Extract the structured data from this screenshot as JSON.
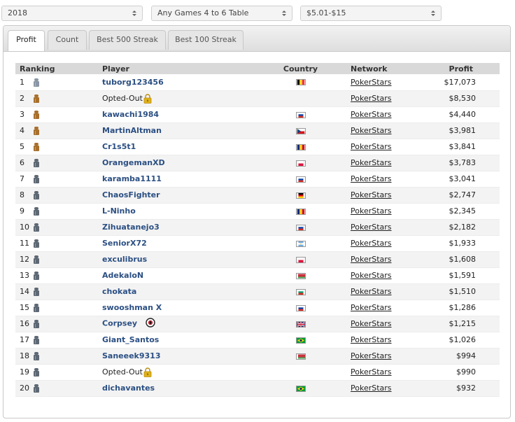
{
  "filters": {
    "year": "2018",
    "games": "Any Games 4 to 6 Table",
    "stakes": "$5.01-$15"
  },
  "tabs": [
    "Profit",
    "Count",
    "Best 500 Streak",
    "Best 100 Streak"
  ],
  "active_tab": "Profit",
  "table": {
    "headers": {
      "ranking": "Ranking",
      "player": "Player",
      "country": "Country",
      "network": "Network",
      "profit": "Profit"
    },
    "rows": [
      {
        "rank": "1",
        "player": "tuborg123456",
        "opted_out": false,
        "country_flag": "belgium",
        "network": "PokerStars",
        "profit": "$17,073",
        "chip": "silver"
      },
      {
        "rank": "2",
        "player": "Opted-Out",
        "opted_out": true,
        "country_flag": "",
        "network": "PokerStars",
        "profit": "$8,530",
        "chip": "bronze"
      },
      {
        "rank": "3",
        "player": "kawachi1984",
        "opted_out": false,
        "country_flag": "russia",
        "network": "PokerStars",
        "profit": "$4,440",
        "chip": "bronze"
      },
      {
        "rank": "4",
        "player": "MartinAltman",
        "opted_out": false,
        "country_flag": "czech",
        "network": "PokerStars",
        "profit": "$3,981",
        "chip": "bronze"
      },
      {
        "rank": "5",
        "player": "Cr1s5t1",
        "opted_out": false,
        "country_flag": "romania",
        "network": "PokerStars",
        "profit": "$3,841",
        "chip": "bronze"
      },
      {
        "rank": "6",
        "player": "OrangemanXD",
        "opted_out": false,
        "country_flag": "poland",
        "network": "PokerStars",
        "profit": "$3,783",
        "chip": "gray"
      },
      {
        "rank": "7",
        "player": "karamba1111",
        "opted_out": false,
        "country_flag": "russia",
        "network": "PokerStars",
        "profit": "$3,041",
        "chip": "gray"
      },
      {
        "rank": "8",
        "player": "ChaosFighter",
        "opted_out": false,
        "country_flag": "germany",
        "network": "PokerStars",
        "profit": "$2,747",
        "chip": "gray"
      },
      {
        "rank": "9",
        "player": "L-Ninho",
        "opted_out": false,
        "country_flag": "romania",
        "network": "PokerStars",
        "profit": "$2,345",
        "chip": "gray"
      },
      {
        "rank": "10",
        "player": "Zihuatanejo3",
        "opted_out": false,
        "country_flag": "russia",
        "network": "PokerStars",
        "profit": "$2,182",
        "chip": "gray"
      },
      {
        "rank": "11",
        "player": "SeniorX72",
        "opted_out": false,
        "country_flag": "argentina",
        "network": "PokerStars",
        "profit": "$1,933",
        "chip": "gray"
      },
      {
        "rank": "12",
        "player": "exculibrus",
        "opted_out": false,
        "country_flag": "poland",
        "network": "PokerStars",
        "profit": "$1,608",
        "chip": "gray"
      },
      {
        "rank": "13",
        "player": "AdekaloN",
        "opted_out": false,
        "country_flag": "belarus",
        "network": "PokerStars",
        "profit": "$1,591",
        "chip": "gray"
      },
      {
        "rank": "14",
        "player": "chokata",
        "opted_out": false,
        "country_flag": "bulgaria",
        "network": "PokerStars",
        "profit": "$1,510",
        "chip": "gray"
      },
      {
        "rank": "15",
        "player": "swooshman X",
        "opted_out": false,
        "country_flag": "russia",
        "network": "PokerStars",
        "profit": "$1,286",
        "chip": "gray"
      },
      {
        "rank": "16",
        "player": "Corpsey",
        "opted_out": false,
        "country_flag": "uk",
        "network": "PokerStars",
        "profit": "$1,215",
        "chip": "gray",
        "badge": true
      },
      {
        "rank": "17",
        "player": "Giant_Santos",
        "opted_out": false,
        "country_flag": "brazil",
        "network": "PokerStars",
        "profit": "$1,026",
        "chip": "gray"
      },
      {
        "rank": "18",
        "player": "Saneeek9313",
        "opted_out": false,
        "country_flag": "belarus",
        "network": "PokerStars",
        "profit": "$994",
        "chip": "gray"
      },
      {
        "rank": "19",
        "player": "Opted-Out",
        "opted_out": true,
        "country_flag": "",
        "network": "PokerStars",
        "profit": "$990",
        "chip": "gray"
      },
      {
        "rank": "20",
        "player": "dichavantes",
        "opted_out": false,
        "country_flag": "brazil",
        "network": "PokerStars",
        "profit": "$932",
        "chip": "gray"
      }
    ]
  },
  "colors": {
    "link": "#2b4f83",
    "header_bg": "#d9d9d9",
    "chip_silver": "#8a96a3",
    "chip_bronze": "#a86f2c",
    "chip_gray": "#5e6874",
    "lock": "#e0b21a"
  }
}
